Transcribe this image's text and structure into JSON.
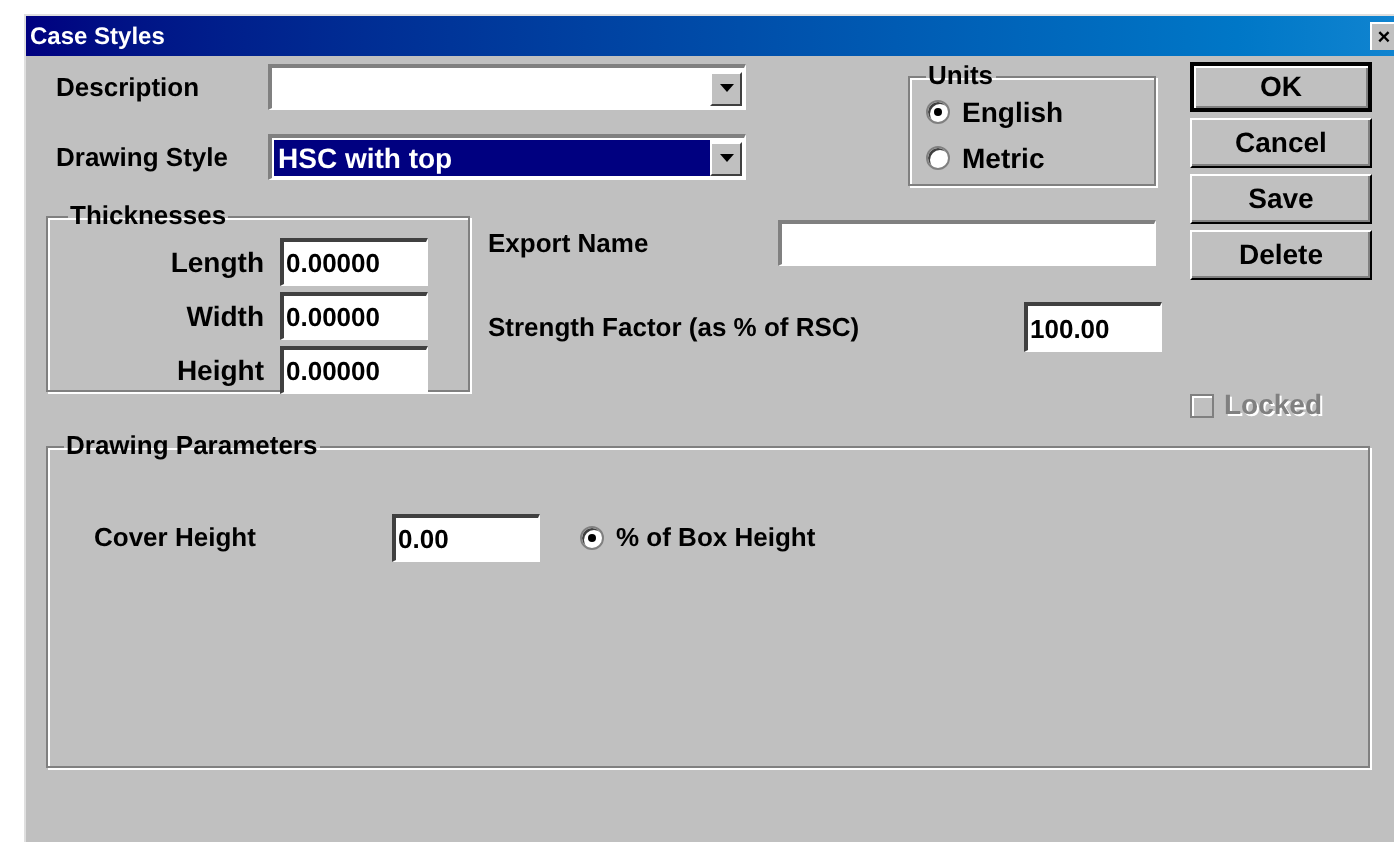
{
  "window": {
    "title": "Case Styles",
    "close": "×"
  },
  "description": {
    "label": "Description"
  },
  "drawing_style": {
    "label": "Drawing Style",
    "value": "HSC with top",
    "highlighted": true
  },
  "thicknesses": {
    "title": "Thicknesses",
    "fields": [
      {
        "label": "Length",
        "value": "0.00000"
      },
      {
        "label": "Width",
        "value": "0.00000"
      },
      {
        "label": "Height",
        "value": "0.00000"
      }
    ]
  },
  "export_name": {
    "label": "Export Name"
  },
  "strength_factor": {
    "label": "Strength Factor (as % of RSC)",
    "value": "100.00"
  },
  "units": {
    "title": "Units",
    "options": [
      {
        "label": "English",
        "selected": true
      },
      {
        "label": "Metric",
        "selected": false
      }
    ]
  },
  "buttons": [
    {
      "label": "OK",
      "default": true
    },
    {
      "label": "Cancel",
      "default": false
    },
    {
      "label": "Save",
      "default": false
    },
    {
      "label": "Delete",
      "default": false
    }
  ],
  "locked": {
    "label": "Locked",
    "checked": false,
    "disabled": true
  },
  "drawing_parameters": {
    "title": "Drawing Parameters",
    "cover_height": {
      "label": "Cover Height",
      "value": "0.00"
    },
    "basis": {
      "label": "% of Box Height",
      "selected": true
    }
  }
}
